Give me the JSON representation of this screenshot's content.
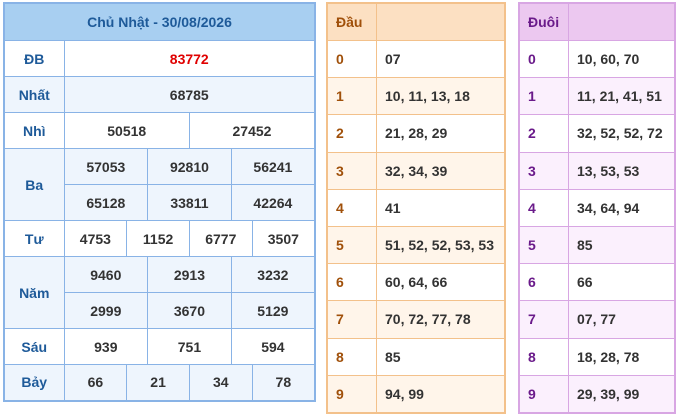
{
  "header": {
    "title": "Chủ Nhật - 30/08/2026"
  },
  "prizes": {
    "db": {
      "label": "ĐB",
      "values": [
        "83772"
      ]
    },
    "nhat": {
      "label": "Nhất",
      "values": [
        "68785"
      ]
    },
    "nhi": {
      "label": "Nhì",
      "values": [
        "50518",
        "27452"
      ]
    },
    "ba": {
      "label": "Ba",
      "values": [
        "57053",
        "92810",
        "56241",
        "65128",
        "33811",
        "42264"
      ]
    },
    "tu": {
      "label": "Tư",
      "values": [
        "4753",
        "1152",
        "6777",
        "3507"
      ]
    },
    "nam": {
      "label": "Năm",
      "values": [
        "9460",
        "2913",
        "3232",
        "2999",
        "3670",
        "5129"
      ]
    },
    "sau": {
      "label": "Sáu",
      "values": [
        "939",
        "751",
        "594"
      ]
    },
    "bay": {
      "label": "Bảy",
      "values": [
        "66",
        "21",
        "34",
        "78"
      ]
    }
  },
  "dau": {
    "label": "Đầu",
    "rows": [
      {
        "k": "0",
        "v": "07"
      },
      {
        "k": "1",
        "v": "10, 11, 13, 18"
      },
      {
        "k": "2",
        "v": "21, 28, 29"
      },
      {
        "k": "3",
        "v": "32, 34, 39"
      },
      {
        "k": "4",
        "v": "41"
      },
      {
        "k": "5",
        "v": "51, 52, 52, 53, 53"
      },
      {
        "k": "6",
        "v": "60, 64, 66"
      },
      {
        "k": "7",
        "v": "70, 72, 77, 78"
      },
      {
        "k": "8",
        "v": "85"
      },
      {
        "k": "9",
        "v": "94, 99"
      }
    ]
  },
  "duoi": {
    "label": "Đuôi",
    "rows": [
      {
        "k": "0",
        "v": "10, 60, 70"
      },
      {
        "k": "1",
        "v": "11, 21, 41, 51"
      },
      {
        "k": "2",
        "v": "32, 52, 52, 72"
      },
      {
        "k": "3",
        "v": "13, 53, 53"
      },
      {
        "k": "4",
        "v": "34, 64, 94"
      },
      {
        "k": "5",
        "v": "85"
      },
      {
        "k": "6",
        "v": "66"
      },
      {
        "k": "7",
        "v": "07, 77"
      },
      {
        "k": "8",
        "v": "18, 28, 78"
      },
      {
        "k": "9",
        "v": "29, 39, 99"
      }
    ]
  },
  "colors": {
    "blue_border": "#89b3e6",
    "blue_header": "#a8cff1",
    "orange_border": "#f3c18b",
    "orange_header": "#fce0c2",
    "purple_border": "#d8a6e3",
    "purple_header": "#ecc8f0",
    "special_prize": "#e00000"
  }
}
